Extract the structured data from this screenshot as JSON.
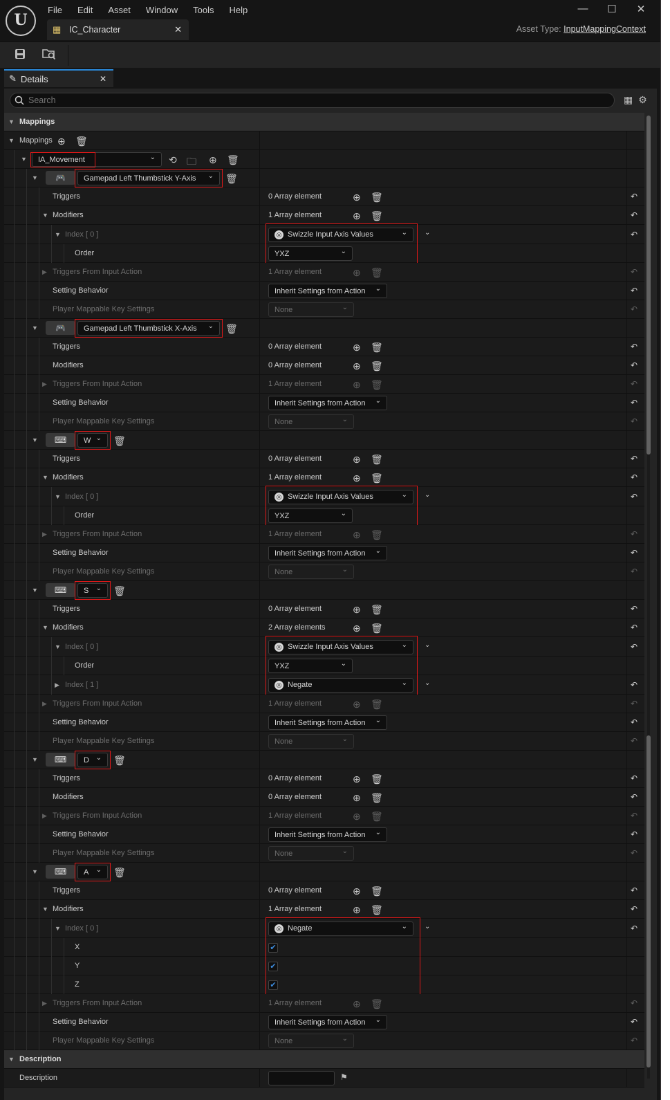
{
  "app": {
    "logo": "U",
    "menu": [
      "File",
      "Edit",
      "Asset",
      "Window",
      "Tools",
      "Help"
    ],
    "tab_title": "IC_Character",
    "asset_type_label": "Asset Type:",
    "asset_type": "InputMappingContext",
    "window_controls": [
      "—",
      "☐",
      "✕"
    ]
  },
  "toolbar": {
    "save": "save-icon",
    "browse": "browse-asset-icon"
  },
  "panel": {
    "tab": "Details",
    "search_placeholder": "Search"
  },
  "sections": {
    "mappings_cat": "Mappings",
    "mappings_prop": "Mappings",
    "action": "IA_Movement",
    "description_cat": "Description",
    "description_prop": "Description",
    "description_value": ""
  },
  "labels": {
    "triggers": "Triggers",
    "modifiers": "Modifiers",
    "tfia": "Triggers From Input Action",
    "setting": "Setting Behavior",
    "pmks": "Player Mappable Key Settings",
    "order": "Order",
    "index0": "Index [ 0 ]",
    "index1": "Index [ 1 ]",
    "x": "X",
    "y": "Y",
    "z": "Z"
  },
  "values": {
    "zero": "0 Array element",
    "one": "1 Array element",
    "two": "2 Array elements",
    "inherit": "Inherit Settings from Action",
    "none": "None",
    "yxz": "YXZ",
    "swizzle": "Swizzle Input Axis Values",
    "negate": "Negate"
  },
  "keys": [
    {
      "name": "Gamepad Left Thumbstick Y-Axis",
      "device": "gamepad"
    },
    {
      "name": "Gamepad Left Thumbstick X-Axis",
      "device": "gamepad"
    },
    {
      "name": "W",
      "device": "keyboard"
    },
    {
      "name": "S",
      "device": "keyboard"
    },
    {
      "name": "D",
      "device": "keyboard"
    },
    {
      "name": "A",
      "device": "keyboard"
    }
  ],
  "checks": {
    "x": true,
    "y": true,
    "z": true
  },
  "colors": {
    "accent": "#2a88d8",
    "highlight": "#e01818",
    "panel": "#242424",
    "row": "#1b1b1b",
    "category": "#2f2f2f"
  }
}
